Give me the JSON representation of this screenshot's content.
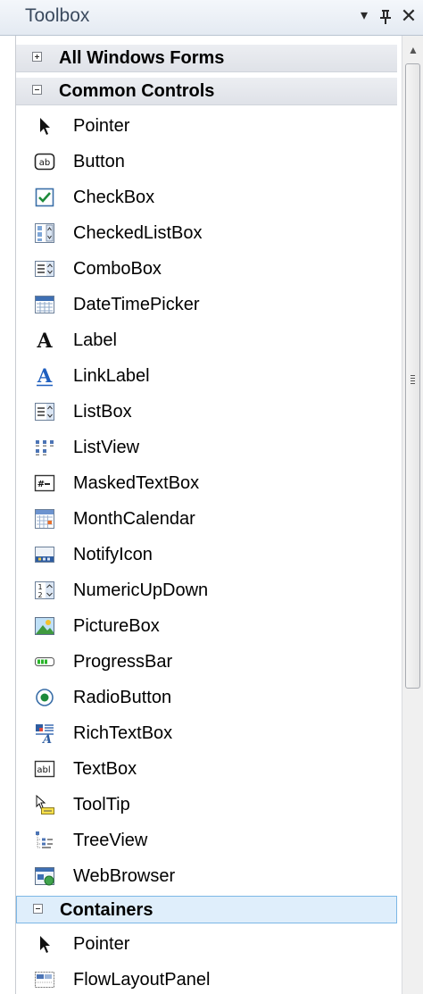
{
  "window": {
    "title": "Toolbox"
  },
  "title_buttons": {
    "dropdown": "▾",
    "pin": "ᵖ",
    "close": "✕"
  },
  "groups": {
    "all_windows_forms": {
      "label": "All Windows Forms",
      "expanded": false
    },
    "common_controls": {
      "label": "Common Controls",
      "expanded": true,
      "items": [
        {
          "label": "Pointer",
          "icon": "pointer-icon"
        },
        {
          "label": "Button",
          "icon": "button-icon"
        },
        {
          "label": "CheckBox",
          "icon": "checkbox-icon"
        },
        {
          "label": "CheckedListBox",
          "icon": "checkedlistbox-icon"
        },
        {
          "label": "ComboBox",
          "icon": "combobox-icon"
        },
        {
          "label": "DateTimePicker",
          "icon": "datetimepicker-icon"
        },
        {
          "label": "Label",
          "icon": "label-icon"
        },
        {
          "label": "LinkLabel",
          "icon": "linklabel-icon"
        },
        {
          "label": "ListBox",
          "icon": "listbox-icon"
        },
        {
          "label": "ListView",
          "icon": "listview-icon"
        },
        {
          "label": "MaskedTextBox",
          "icon": "maskedtextbox-icon"
        },
        {
          "label": "MonthCalendar",
          "icon": "monthcalendar-icon"
        },
        {
          "label": "NotifyIcon",
          "icon": "notifyicon-icon"
        },
        {
          "label": "NumericUpDown",
          "icon": "numericupdown-icon"
        },
        {
          "label": "PictureBox",
          "icon": "picturebox-icon"
        },
        {
          "label": "ProgressBar",
          "icon": "progressbar-icon"
        },
        {
          "label": "RadioButton",
          "icon": "radiobutton-icon"
        },
        {
          "label": "RichTextBox",
          "icon": "richtextbox-icon"
        },
        {
          "label": "TextBox",
          "icon": "textbox-icon"
        },
        {
          "label": "ToolTip",
          "icon": "tooltip-icon"
        },
        {
          "label": "TreeView",
          "icon": "treeview-icon"
        },
        {
          "label": "WebBrowser",
          "icon": "webbrowser-icon"
        }
      ]
    },
    "containers": {
      "label": "Containers",
      "expanded": true,
      "selected": true,
      "items": [
        {
          "label": "Pointer",
          "icon": "pointer-icon"
        },
        {
          "label": "FlowLayoutPanel",
          "icon": "flowlayoutpanel-icon"
        }
      ]
    }
  },
  "colors": {
    "selected_header": "#dfeefb",
    "selected_border": "#7cb7e6",
    "link_blue": "#1f5fbf"
  }
}
